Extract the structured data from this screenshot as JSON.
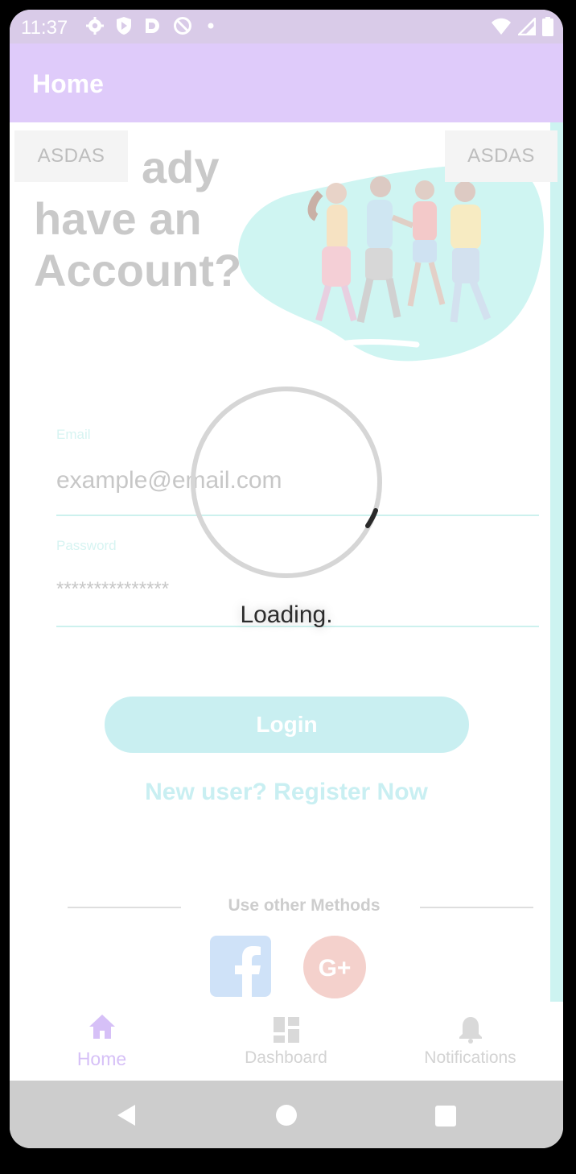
{
  "status_bar": {
    "time": "11:37",
    "left_icons": [
      "settings-icon",
      "shield-play-icon",
      "d-logo-icon",
      "blocked-icon",
      "dot-icon"
    ],
    "right_icons": [
      "wifi-icon",
      "signal-icon",
      "battery-icon"
    ]
  },
  "app_bar": {
    "title": "Home"
  },
  "login_screen": {
    "headline_line1": "ady",
    "headline_line2": "have an",
    "headline_line3": "Account?",
    "chip_left": "ASDAS",
    "chip_right": "ASDAS",
    "email_label": "Email",
    "email_value": "example@email.com",
    "password_label": "Password",
    "password_value": "***************",
    "login_button": "Login",
    "register_link": "New user? Register Now",
    "other_methods": "Use other Methods",
    "social": [
      "facebook-icon",
      "google-plus-icon"
    ]
  },
  "loading": {
    "text": "Loading."
  },
  "bottom_nav": {
    "items": [
      {
        "label": "Home",
        "icon": "home-icon",
        "active": true
      },
      {
        "label": "Dashboard",
        "icon": "dashboard-icon",
        "active": false
      },
      {
        "label": "Notifications",
        "icon": "bell-icon",
        "active": false
      }
    ]
  },
  "system_nav": [
    "back-icon",
    "home-circle-icon",
    "recents-icon"
  ],
  "colors": {
    "app_bar": "#dfcbfa",
    "status_bar": "#d9cbe8",
    "accent_teal": "#c9eff1",
    "active_nav": "#d6c0f7"
  }
}
